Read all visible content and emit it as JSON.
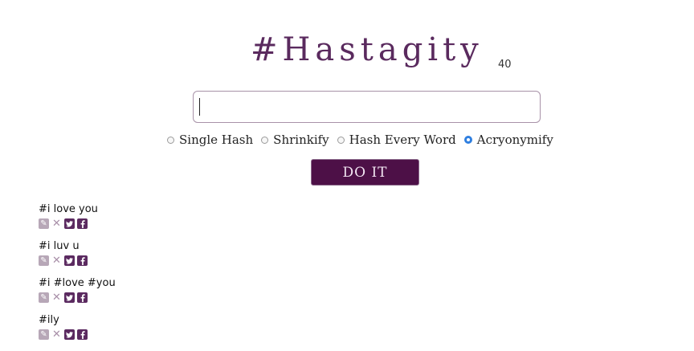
{
  "title": "#Hastagity",
  "char_counter": "40",
  "input": {
    "value": "",
    "placeholder": ""
  },
  "options": [
    {
      "label": "Single Hash",
      "checked": false
    },
    {
      "label": "Shrinkify",
      "checked": false
    },
    {
      "label": "Hash Every Word",
      "checked": false
    },
    {
      "label": "Acryonymify",
      "checked": true
    }
  ],
  "submit_label": "DO IT",
  "results": [
    {
      "text": "#i love you"
    },
    {
      "text": "#i luv u"
    },
    {
      "text": "#i #love #you"
    },
    {
      "text": "#ily"
    }
  ],
  "icons": {
    "edit": "pencil-icon",
    "remove": "close-icon",
    "twitter": "twitter-icon",
    "facebook": "facebook-icon"
  },
  "colors": {
    "brand": "#5a2a5e",
    "button_bg": "#4d1047",
    "radio_selected": "#2f7fe0"
  }
}
